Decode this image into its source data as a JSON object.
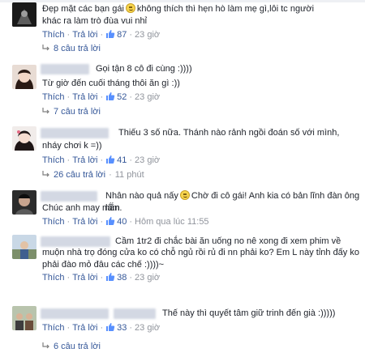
{
  "comments": [
    {
      "text": "Đẹp mặt các bạn gái  không thích thì hẹn hò làm mẹ gì,lôi tc người khác ra làm trò đùa vui nhỉ",
      "line1": "Đẹp mặt các bạn gái",
      "line1b": "không thích thì hẹn hò làm mẹ gì,lôi tc người",
      "line2": "khác ra làm trò đùa vui nhỉ",
      "like_label": "Thích",
      "reply_label": "Trả lời",
      "likes": "87",
      "time": "23 giờ",
      "replies": "8 câu trả lời",
      "replies_time": ""
    },
    {
      "line1": "Gọi tận 8 cô đi cùng :))))",
      "line2": "Từ giờ đến cuối tháng thôi ăn gì :))",
      "like_label": "Thích",
      "reply_label": "Trả lời",
      "likes": "52",
      "time": "23 giờ",
      "replies": "7 câu trả lời",
      "replies_time": ""
    },
    {
      "line1": "Thiếu 3 số nữa. Thánh nào rảnh ngồi đoán số với mình,",
      "line2": "nháy chơi k =))",
      "like_label": "Thích",
      "reply_label": "Trả lời",
      "likes": "41",
      "time": "23 giờ",
      "replies": "26 câu trả lời",
      "replies_time": "11 phút"
    },
    {
      "line1": "Nhân nào quả nấy",
      "line1b": "Chờ đi cô gái! Anh kia có bản lĩnh đàn ông lắm",
      "line2": "Chúc anh may mắn.",
      "like_label": "Thích",
      "reply_label": "Trả lời",
      "likes": "40",
      "time": "Hôm qua lúc 11:55",
      "replies": "",
      "replies_time": ""
    },
    {
      "line1": "Cầm 1tr2 đi chắc bài ăn uống no nê xong đi xem phim về",
      "line2": "muộn nhà trọ đóng cửa ko có chỗ ngủ rồi rủ đi nn phải ko? Em L này tỉnh đấy ko",
      "line3": "phải đào mỏ đâu các chế :))))~",
      "like_label": "Thích",
      "reply_label": "Trả lời",
      "likes": "38",
      "time": "23 giờ",
      "replies": "",
      "replies_time": ""
    },
    {
      "line1": "Thế này thì quyết tâm giữ trinh đến già :)))))",
      "like_label": "Thích",
      "reply_label": "Trả lời",
      "likes": "33",
      "time": "23 giờ",
      "replies": "6 câu trả lời",
      "replies_time": ""
    }
  ],
  "colors": {
    "link": "#365899",
    "meta": "#90949c",
    "text": "#1d2129",
    "blurred_name": "#d3d8e3"
  },
  "icons": {
    "like": "thumbs-up-icon",
    "reply": "reply-arrow-icon",
    "emoji": "smiley-emoji-icon"
  }
}
